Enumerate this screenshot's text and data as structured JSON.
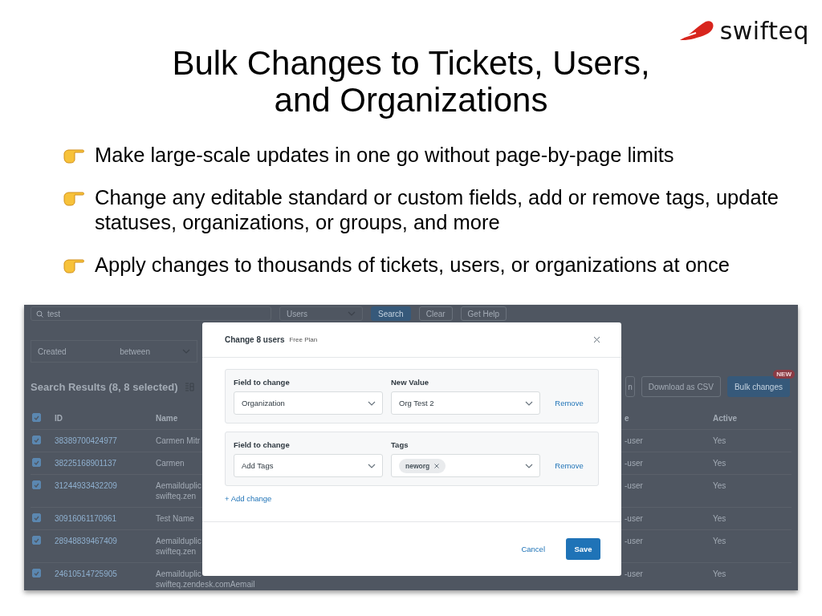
{
  "logo": {
    "text": "swifteq"
  },
  "title": "Bulk Changes to Tickets, Users, and Organizations",
  "bullets": [
    "Make large-scale updates in one go without page-by-page limits",
    "Change any editable standard or custom fields, add or remove tags, update statuses, organizations, or groups, and more",
    "Apply changes to thousands of tickets, users, or organizations at once"
  ],
  "app": {
    "search": {
      "value": "test"
    },
    "type_select": "Users",
    "top_buttons": [
      {
        "label": "Search",
        "kind": "primary"
      },
      {
        "label": "Clear",
        "kind": "outline"
      },
      {
        "label": "Get Help",
        "kind": "outline"
      }
    ],
    "filter": {
      "field": "Created",
      "operator": "between"
    },
    "results_title": "Search Results (8, 8 selected)",
    "actions": [
      {
        "label": "n",
        "kind": "outline"
      },
      {
        "label": "Download as CSV",
        "kind": "outline"
      },
      {
        "label": "Bulk changes",
        "kind": "primary",
        "badge": "NEW"
      }
    ],
    "table": {
      "header_checked": true,
      "columns": [
        "ID",
        "Name",
        "e",
        "Active"
      ],
      "rows": [
        {
          "checked": true,
          "id": "38389700424977",
          "name": [
            "Carmen Mitr"
          ],
          "role": "-user",
          "active": "Yes"
        },
        {
          "checked": true,
          "id": "38225168901137",
          "name": [
            "Carmen"
          ],
          "role": "-user",
          "active": "Yes"
        },
        {
          "checked": true,
          "id": "31244933432209",
          "name": [
            "Aemailduplic",
            "swifteq.zen"
          ],
          "role": "-user",
          "active": "Yes"
        },
        {
          "checked": true,
          "id": "30916061170961",
          "name": [
            "Test Name"
          ],
          "role": "-user",
          "active": "Yes"
        },
        {
          "checked": true,
          "id": "28948839467409",
          "name": [
            "Aemailduplic",
            "swifteq.zen"
          ],
          "role": "-user",
          "active": "Yes"
        },
        {
          "checked": true,
          "id": "24610514725905",
          "name": [
            "Aemailduplic",
            "swifteq.zendesk.comAemail"
          ],
          "role": "-user",
          "active": "Yes"
        }
      ]
    }
  },
  "modal": {
    "title": "Change 8 users",
    "plan": "Free Plan",
    "changes": [
      {
        "kind": "select",
        "field_label": "Field to change",
        "field": "Organization",
        "value_label": "New Value",
        "value": "Org Test 2",
        "remove": "Remove"
      },
      {
        "kind": "tags",
        "field_label": "Field to change",
        "field": "Add Tags",
        "value_label": "Tags",
        "tags": [
          "neworg"
        ],
        "remove": "Remove"
      }
    ],
    "add_change": "+ Add change",
    "cancel": "Cancel",
    "save": "Save"
  }
}
